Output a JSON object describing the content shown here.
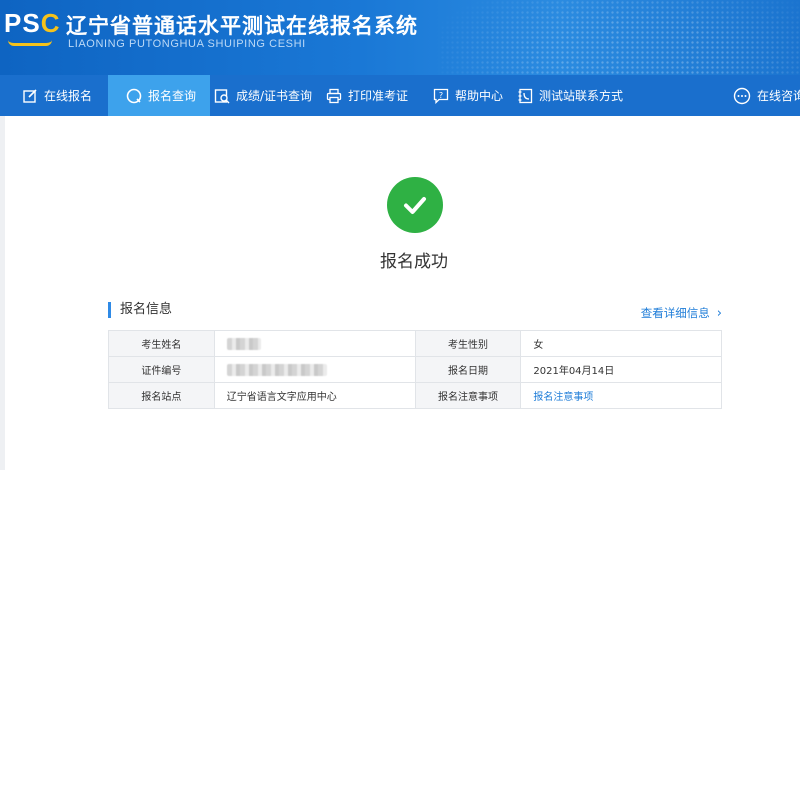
{
  "header": {
    "logo_text": "PSC",
    "title": "辽宁省普通话水平测试在线报名系统",
    "subtitle": "LIAONING PUTONGHUA SHUIPING CESHI"
  },
  "nav": {
    "items": [
      {
        "label": "在线报名",
        "icon": "edit-icon"
      },
      {
        "label": "报名查询",
        "icon": "search-circle-icon",
        "active": true
      },
      {
        "label": "成绩/证书查询",
        "icon": "certificate-search-icon"
      },
      {
        "label": "打印准考证",
        "icon": "printer-icon"
      },
      {
        "label": "帮助中心",
        "icon": "help-icon"
      },
      {
        "label": "测试站联系方式",
        "icon": "phone-book-icon"
      },
      {
        "label": "在线咨询",
        "icon": "chat-icon"
      }
    ]
  },
  "result": {
    "status_icon": "check-circle-icon",
    "message": "报名成功"
  },
  "info": {
    "section_title": "报名信息",
    "detail_link": "查看详细信息",
    "rows": [
      {
        "label1": "考生姓名",
        "value1": "",
        "label2": "考生性别",
        "value2": "女"
      },
      {
        "label1": "证件编号",
        "value1": "",
        "label2": "报名日期",
        "value2": "2021年04月14日"
      },
      {
        "label1": "报名站点",
        "value1": "辽宁省语言文字应用中心",
        "label2": "报名注意事项",
        "value2": "报名注意事项"
      }
    ]
  },
  "colors": {
    "primary_blue": "#1a6fcd",
    "active_tab": "#3da2ec",
    "success_green": "#2fb144",
    "link_blue": "#1f7dd8"
  }
}
